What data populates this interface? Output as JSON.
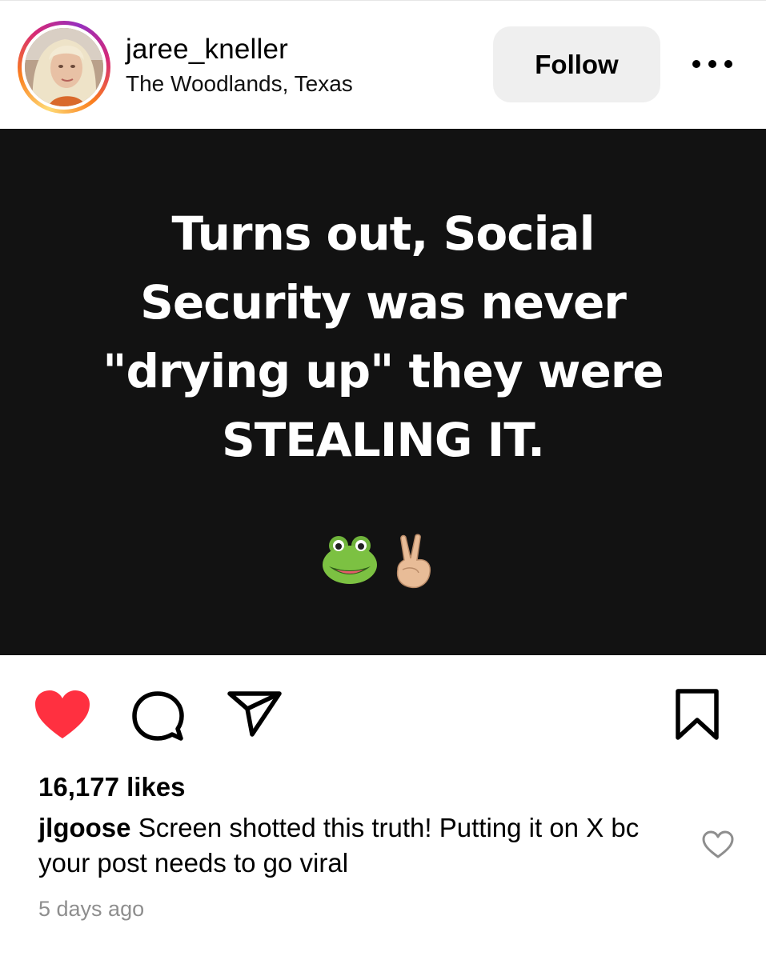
{
  "header": {
    "username": "jaree_kneller",
    "location": "The Woodlands, Texas",
    "follow_label": "Follow",
    "more_icon": "more-horizontal-icon"
  },
  "post": {
    "text_lines": [
      "Turns out, Social",
      "Security was never",
      "\"drying up\" they were",
      "STEALING IT."
    ],
    "emojis": [
      "frog-face",
      "victory-hand"
    ],
    "background_color": "#121212",
    "text_color": "#ffffff"
  },
  "actions": {
    "like_icon": "heart-icon",
    "liked": true,
    "like_color": "#ff3040",
    "comment_icon": "comment-icon",
    "share_icon": "share-icon",
    "save_icon": "bookmark-icon"
  },
  "likes_text": "16,177 likes",
  "top_comment": {
    "author": "jlgoose",
    "text": "Screen shotted this truth! Putting it on X bc your post needs to go viral",
    "like_icon": "heart-outline-icon"
  },
  "timestamp": "5 days ago"
}
